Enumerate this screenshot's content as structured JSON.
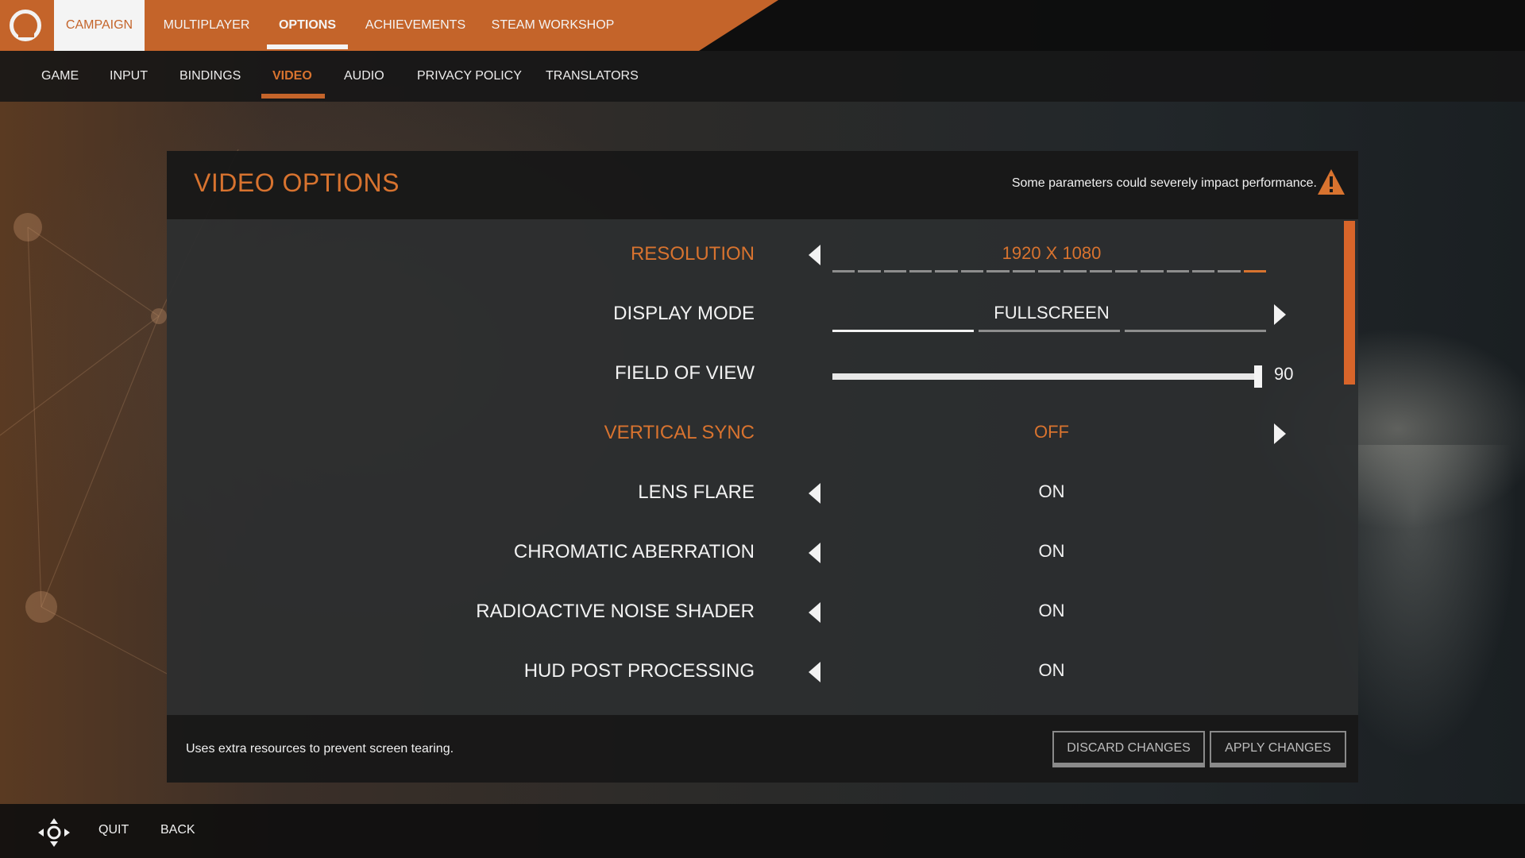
{
  "top_nav": {
    "tabs": [
      {
        "label": "CAMPAIGN"
      },
      {
        "label": "MULTIPLAYER"
      },
      {
        "label": "OPTIONS"
      },
      {
        "label": "ACHIEVEMENTS"
      },
      {
        "label": "STEAM WORKSHOP"
      }
    ],
    "active_tab": "OPTIONS"
  },
  "sub_nav": {
    "tabs": [
      {
        "label": "GAME"
      },
      {
        "label": "INPUT"
      },
      {
        "label": "BINDINGS"
      },
      {
        "label": "VIDEO"
      },
      {
        "label": "AUDIO"
      },
      {
        "label": "PRIVACY POLICY"
      },
      {
        "label": "TRANSLATORS"
      }
    ],
    "active_tab": "VIDEO"
  },
  "panel": {
    "title": "VIDEO OPTIONS",
    "warning": "Some parameters could severely impact performance.",
    "options": [
      {
        "label": "RESOLUTION",
        "value": "1920 X 1080"
      },
      {
        "label": "DISPLAY MODE",
        "value": "FULLSCREEN"
      },
      {
        "label": "FIELD OF VIEW",
        "value": "90",
        "slider_fraction": 1.0
      },
      {
        "label": "VERTICAL SYNC",
        "value": "OFF"
      },
      {
        "label": "LENS FLARE",
        "value": "ON"
      },
      {
        "label": "CHROMATIC ABERRATION",
        "value": "ON"
      },
      {
        "label": "RADIOACTIVE NOISE SHADER",
        "value": "ON"
      },
      {
        "label": "HUD POST PROCESSING",
        "value": "ON"
      }
    ],
    "description": "Uses extra resources to prevent screen tearing.",
    "discard_label": "DISCARD CHANGES",
    "apply_label": "APPLY CHANGES"
  },
  "bottom_bar": {
    "quit_label": "QUIT",
    "back_label": "BACK"
  },
  "icons": {
    "logo": "game-logo-icon",
    "warning": "warning-triangle-icon",
    "navigation": "dpad-navigation-icon"
  },
  "colors": {
    "accent": "#c4642a",
    "accent_text": "#d8732f"
  }
}
